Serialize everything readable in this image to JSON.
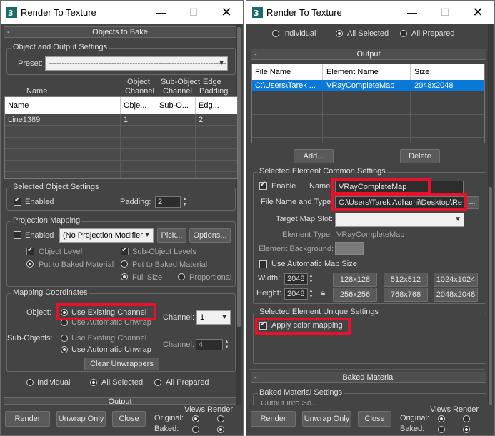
{
  "left": {
    "title": "Render To Texture",
    "rollout_title": "Objects to Bake",
    "object_output_group": "Object and Output Settings",
    "preset_label": "Preset:",
    "preset_value": "--------------------------------------------------------------------",
    "table": {
      "col_name": "Name",
      "col_obj_channel": [
        "Object",
        "Channel"
      ],
      "col_subobj_channel": [
        "Sub-Object",
        "Channel"
      ],
      "col_edge_padding": [
        "Edge",
        "Padding"
      ],
      "header_row": [
        "Name",
        "Obje...",
        "Sub-O...",
        "Edg..."
      ],
      "rows": [
        [
          "Line1389",
          "1",
          "",
          "2"
        ]
      ]
    },
    "selected_object_group": "Selected Object Settings",
    "enabled_label": "Enabled",
    "padding_label": "Padding:",
    "padding_value": "2",
    "projection_group": "Projection Mapping",
    "proj_enabled_label": "Enabled",
    "proj_modifier": "(No Projection Modifier",
    "pick_label": "Pick...",
    "options_label": "Options...",
    "object_level": "Object Level",
    "sub_object_levels": "Sub-Object Levels",
    "put_baked_1": "Put to Baked Material",
    "put_baked_2": "Put to Baked Material",
    "full_size": "Full Size",
    "proportional": "Proportional",
    "mapping_group": "Mapping Coordinates",
    "object_label": "Object:",
    "use_existing_channel": "Use Existing Channel",
    "use_auto_unwrap": "Use Automatic Unwrap",
    "channel_label": "Channel:",
    "channel_value": "1",
    "sub_objects_label": "Sub-Objects:",
    "sub_use_existing": "Use Existing Channel",
    "sub_use_auto": "Use Automatic Unwrap",
    "sub_channel_label": "Channel:",
    "sub_channel_value": "4",
    "clear_unwrappers": "Clear Unwrappers",
    "individual": "Individual",
    "all_selected": "All Selected",
    "all_prepared": "All Prepared",
    "output_rollout": "Output",
    "render": "Render",
    "unwrap_only": "Unwrap Only",
    "close": "Close",
    "views": "Views",
    "render_col": "Render",
    "original": "Original:",
    "baked": "Baked:"
  },
  "right": {
    "title": "Render To Texture",
    "individual": "Individual",
    "all_selected": "All Selected",
    "all_prepared": "All Prepared",
    "output_rollout": "Output",
    "table": {
      "headers": [
        "File Name",
        "Element Name",
        "Size"
      ],
      "rows": [
        [
          "C:\\Users\\Tarek ...",
          "VRayCompleteMap",
          "2048x2048"
        ]
      ]
    },
    "add": "Add...",
    "delete": "Delete",
    "common_group": "Selected Element Common Settings",
    "enable": "Enable",
    "name_label": "Name:",
    "name_value": "VRayCompleteMap",
    "file_label": "File Name and Type:",
    "file_value": "C:\\Users\\Tarek Adhami\\Desktop\\Re",
    "browse": "...",
    "target_slot_label": "Target Map Slot:",
    "element_type_label": "Element Type:",
    "element_type_value": "VRayCompleteMap",
    "element_bg_label": "Element Background:",
    "use_auto_map_size": "Use Automatic Map Size",
    "width_label": "Width:",
    "width_value": "2048",
    "height_label": "Height:",
    "height_value": "2048",
    "sizes": [
      "128x128",
      "512x512",
      "1024x1024",
      "256x256",
      "768x768",
      "2048x2048"
    ],
    "unique_group": "Selected Element Unique Settings",
    "apply_color_mapping": "Apply color mapping",
    "baked_material_rollout": "Baked Material",
    "baked_material_settings": "Baked Material Settings",
    "cutoff_text": "Output Into So...",
    "render": "Render",
    "unwrap_only": "Unwrap Only",
    "close": "Close",
    "views": "Views",
    "render_col": "Render",
    "original": "Original:",
    "baked": "Baked:"
  },
  "colors": {
    "highlight": "#e8102a",
    "selection": "#0a78d7",
    "panel": "#444444"
  }
}
